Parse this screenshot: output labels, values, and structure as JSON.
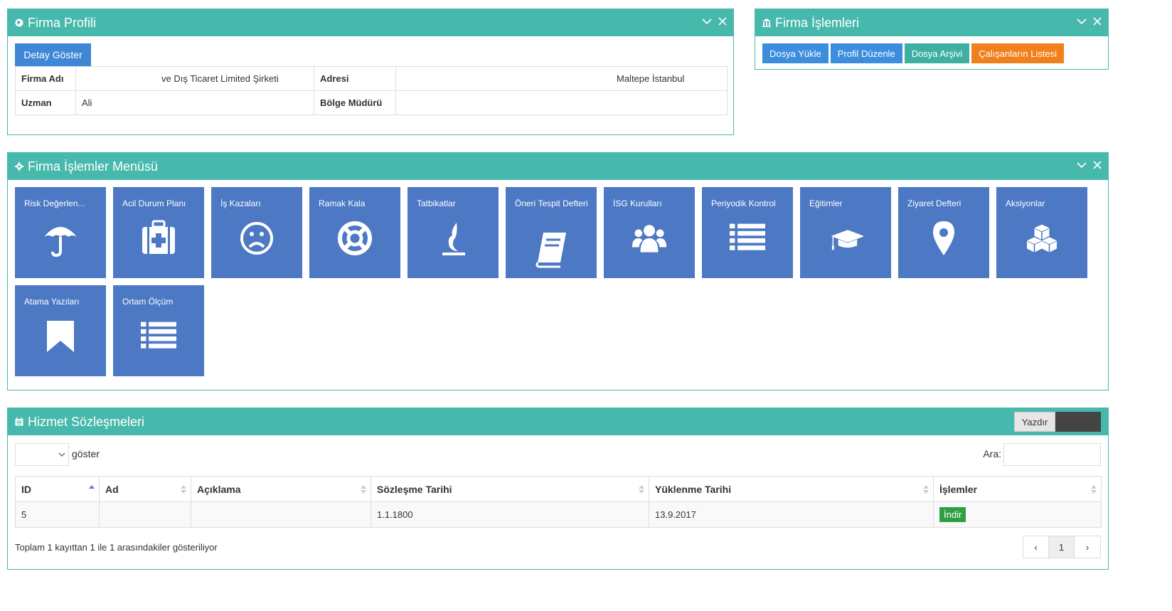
{
  "profile": {
    "title": "Firma Profili",
    "detail_button": "Detay Göster",
    "rows": [
      {
        "label1": "Firma Adı",
        "value1": "ve Dış Ticaret Limited Şirketi",
        "label2": "Adresi",
        "value2": "Maltepe İstanbul"
      },
      {
        "label1": "Uzman",
        "value1": "Ali",
        "label2": "Bölge Müdürü",
        "value2": ""
      }
    ]
  },
  "operations": {
    "title": "Firma İşlemleri",
    "buttons": [
      {
        "label": "Dosya Yükle",
        "color": "#3c8dde"
      },
      {
        "label": "Profil Düzenle",
        "color": "#3c8dde"
      },
      {
        "label": "Dosya Arşivi",
        "color": "#3db0a3"
      },
      {
        "label": "Çalışanların Listesi",
        "color": "#f07f1c"
      }
    ]
  },
  "menu": {
    "title": "Firma İşlemler Menüsü",
    "tiles": [
      {
        "label": "Risk Değerlen...",
        "icon": "umbrella-icon"
      },
      {
        "label": "Acil Durum Planı",
        "icon": "medkit-icon"
      },
      {
        "label": "İş Kazaları",
        "icon": "frown-icon"
      },
      {
        "label": "Ramak Kala",
        "icon": "lifebuoy-icon"
      },
      {
        "label": "Tatbikatlar",
        "icon": "fire-icon"
      },
      {
        "label": "Öneri Tespit Defteri",
        "icon": "book-icon"
      },
      {
        "label": "İSG Kurulları",
        "icon": "users-icon"
      },
      {
        "label": "Periyodik Kontrol",
        "icon": "list-icon"
      },
      {
        "label": "Eğitimler",
        "icon": "graduation-cap-icon"
      },
      {
        "label": "Ziyaret Defteri",
        "icon": "map-marker-icon"
      },
      {
        "label": "Aksiyonlar",
        "icon": "cubes-icon"
      },
      {
        "label": "Atama Yazıları",
        "icon": "bookmark-icon"
      },
      {
        "label": "Ortam Ölçüm",
        "icon": "list-icon"
      }
    ]
  },
  "service": {
    "title": "Hizmet Sözleşmeleri",
    "print_button": "Yazdır",
    "length_label": "göster",
    "search_label": "Ara:",
    "columns": [
      "ID",
      "Ad",
      "Açıklama",
      "Sözleşme Tarihi",
      "Yüklenme Tarihi",
      "İşlemler"
    ],
    "rows": [
      {
        "id": "5",
        "ad": "",
        "aciklama": "",
        "sozlesme": "1.1.1800",
        "yuklenme": "13.9.2017",
        "action": "İndir"
      }
    ],
    "info": "Toplam 1 kayıttan 1 ile 1 arasındakiler gösteriliyor",
    "pager": {
      "prev": "‹",
      "page": "1",
      "next": "›"
    }
  },
  "colors": {
    "accent": "#47b8ac",
    "tile": "#4c78c4",
    "primary": "#3c8dde",
    "success": "#2ea043"
  }
}
